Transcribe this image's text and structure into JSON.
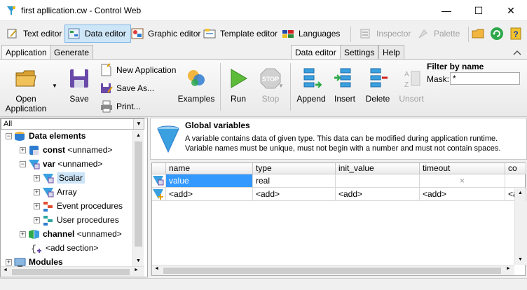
{
  "window": {
    "title": "first apllication.cw - Control Web",
    "minimize": "—",
    "maximize": "☐",
    "close": "✕"
  },
  "modebar": {
    "items": [
      {
        "label": "Text editor",
        "icon": "text-editor-icon"
      },
      {
        "label": "Data editor",
        "icon": "data-editor-icon",
        "active": true
      },
      {
        "label": "Graphic editor",
        "icon": "graphic-editor-icon"
      },
      {
        "label": "Template editor",
        "icon": "template-editor-icon"
      },
      {
        "label": "Languages",
        "icon": "languages-icon"
      },
      {
        "label": "Inspector",
        "icon": "inspector-icon",
        "disabled": true
      },
      {
        "label": "Palette",
        "icon": "palette-icon",
        "disabled": true
      }
    ]
  },
  "tabs_left": [
    "Application",
    "Generate"
  ],
  "tabs_right": [
    "Data editor",
    "Settings",
    "Help"
  ],
  "ribbon": {
    "open": "Open\nApplication",
    "open_line1": "Open",
    "open_line2": "Application",
    "save": "Save",
    "new_application": "New Application",
    "save_as": "Save As...",
    "print": "Print...",
    "examples": "Examples",
    "run": "Run",
    "stop": "Stop",
    "append": "Append",
    "insert": "Insert",
    "delete": "Delete",
    "unsort": "Unsort",
    "filter_title": "Filter by name",
    "mask_label": "Mask:",
    "mask_value": "*"
  },
  "tree": {
    "combo_value": "All",
    "items": [
      {
        "label": "Data elements",
        "sub": "",
        "bold": true
      },
      {
        "label": "const",
        "sub": "<unnamed>",
        "bold": true
      },
      {
        "label": "var",
        "sub": "<unnamed>",
        "bold": true
      },
      {
        "label": "Scalar",
        "sub": "",
        "selected": true
      },
      {
        "label": "Array",
        "sub": ""
      },
      {
        "label": "Event procedures",
        "sub": ""
      },
      {
        "label": "User procedures",
        "sub": ""
      },
      {
        "label": "channel",
        "sub": "<unnamed>",
        "bold": true
      },
      {
        "label": "<add section>",
        "sub": ""
      },
      {
        "label": "Modules",
        "sub": "",
        "bold": true
      }
    ]
  },
  "panel": {
    "title": "Global variables",
    "description": "A variable contains data of given type. This data can be modified during application runtime. Variable names must be unique, must not begin with a number and must not contain spaces."
  },
  "grid": {
    "columns": [
      "name",
      "type",
      "init_value",
      "timeout",
      "co"
    ],
    "rows": [
      [
        "value",
        "real",
        "",
        "×",
        ""
      ],
      [
        "<add>",
        "<add>",
        "<add>",
        "<add>",
        "<a"
      ]
    ]
  },
  "colors": {
    "accent": "#cde6f7",
    "selected_cell": "#3399ff",
    "tree_selected": "#cce4f7"
  }
}
